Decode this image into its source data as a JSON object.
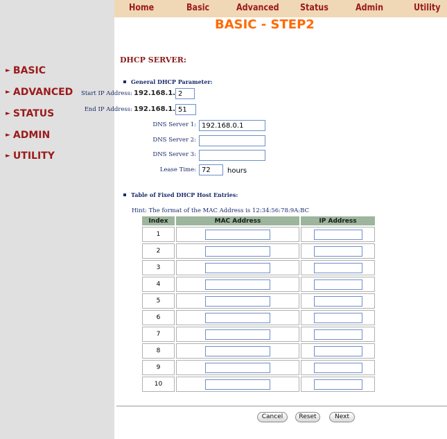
{
  "top_nav": [
    "Home",
    "Basic",
    "Advanced",
    "Status",
    "Admin",
    "Utility"
  ],
  "page_title": "BASIC - STEP2",
  "sidebar": [
    "BASIC",
    "ADVANCED",
    "STATUS",
    "ADMIN",
    "UTILITY"
  ],
  "section_title": "DHCP SERVER:",
  "general": {
    "heading": "General DHCP Parameter:",
    "start_ip_label": "Start IP Address:",
    "start_ip_prefix": "192.168.1.",
    "start_ip_value": "2",
    "end_ip_label": "End IP Address:",
    "end_ip_prefix": "192.168.1.",
    "end_ip_value": "51",
    "dns1_label": "DNS Server 1:",
    "dns1_value": "192.168.0.1",
    "dns2_label": "DNS Server 2:",
    "dns2_value": "",
    "dns3_label": "DNS Server 3:",
    "dns3_value": "",
    "lease_label": "Lease Time:",
    "lease_value": "72",
    "lease_unit": "hours"
  },
  "fixed_hosts": {
    "heading": "Table of Fixed DHCP Host Entries:",
    "hint": "Hint: The format of the MAC Address is 12:34:56:78:9A:BC",
    "columns": [
      "Index",
      "MAC Address",
      "IP Address"
    ],
    "rows": [
      "1",
      "2",
      "3",
      "4",
      "5",
      "6",
      "7",
      "8",
      "9",
      "10"
    ]
  },
  "buttons": {
    "cancel": "Cancel",
    "reset": "Reset",
    "next": "Next"
  }
}
